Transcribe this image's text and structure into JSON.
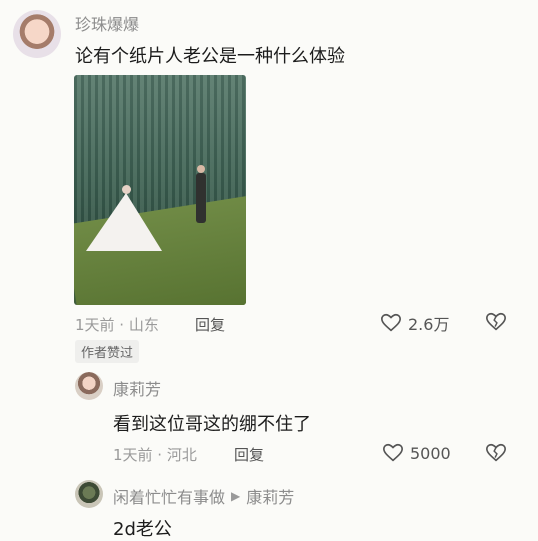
{
  "comment": {
    "username": "珍珠爆爆",
    "text": "论有个纸片人老公是一种什么体验",
    "time_location": "1天前 · 山东",
    "reply_label": "回复",
    "like_count": "2.6万",
    "author_badge": "作者赞过"
  },
  "replies": [
    {
      "username": "康莉芳",
      "text": "看到这位哥这的绷不住了",
      "time_location": "1天前 · 河北",
      "reply_label": "回复",
      "like_count": "5000"
    },
    {
      "username": "闲着忙忙有事做",
      "reply_to": "康莉芳",
      "text": "2d老公"
    }
  ]
}
